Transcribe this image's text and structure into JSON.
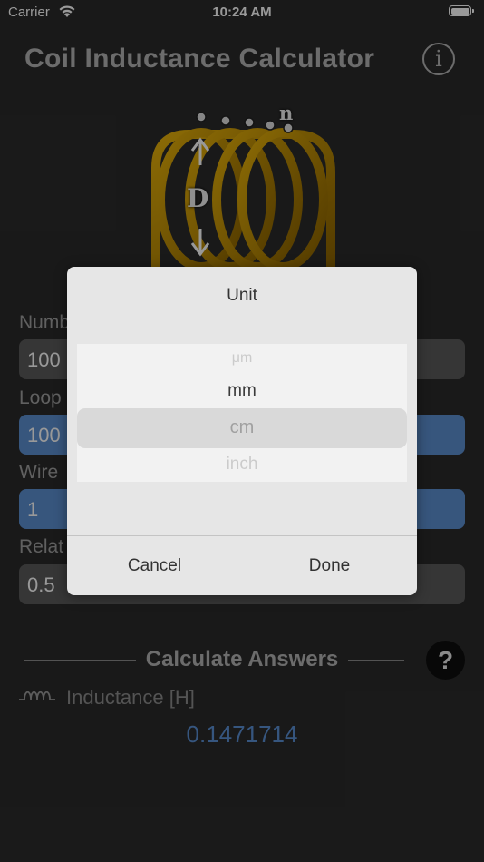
{
  "status_bar": {
    "carrier": "Carrier",
    "time": "10:24 AM"
  },
  "header": {
    "title": "Coil Inductance Calculator",
    "info_icon": "info-circle-icon",
    "info_glyph": "i"
  },
  "diagram": {
    "label_d": "D",
    "label_n": "n",
    "wire_color": "#c69400"
  },
  "fields": [
    {
      "label": "Numb",
      "value": "100"
    },
    {
      "label": "Loop",
      "value": "100"
    },
    {
      "label": "Wire",
      "value": "1"
    },
    {
      "label": "Relat",
      "value": "0.5"
    }
  ],
  "calculate": {
    "title": "Calculate Answers",
    "help_glyph": "?"
  },
  "result": {
    "label": "Inductance [H]",
    "value": "0.1471714",
    "color": "#5b8fd4"
  },
  "picker": {
    "title": "Unit",
    "options": [
      "μm",
      "mm",
      "cm",
      "inch"
    ],
    "selected": "cm",
    "cancel_label": "Cancel",
    "done_label": "Done"
  }
}
